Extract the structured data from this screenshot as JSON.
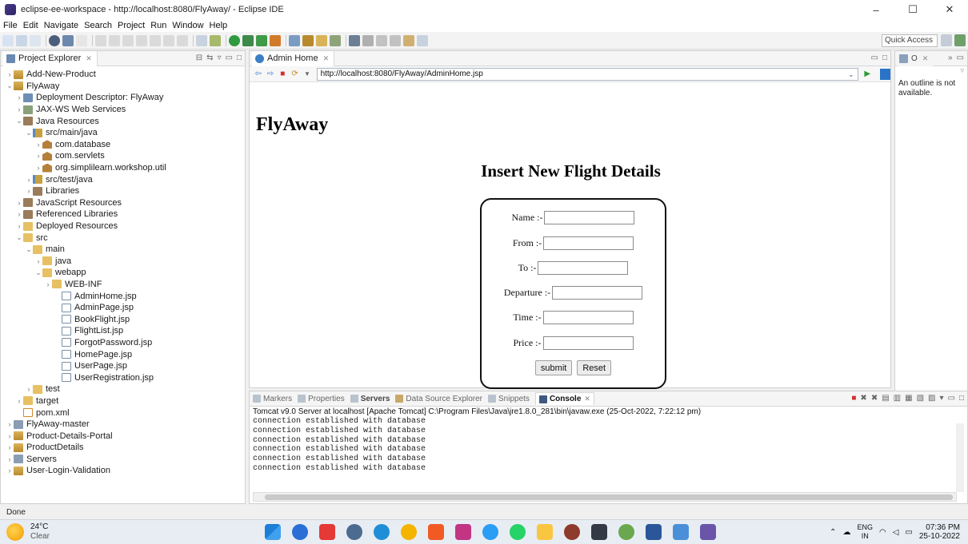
{
  "window": {
    "title": "eclipse-ee-workspace - http://localhost:8080/FlyAway/ - Eclipse IDE",
    "controls": [
      "–",
      "☐",
      "✕"
    ]
  },
  "menu": [
    "File",
    "Edit",
    "Navigate",
    "Search",
    "Project",
    "Run",
    "Window",
    "Help"
  ],
  "toolbar": {
    "quick_access": "Quick Access"
  },
  "project_explorer": {
    "title": "Project Explorer",
    "tree": [
      {
        "label": "Add-New-Product",
        "depth": 0,
        "chev": ">",
        "icon": "proj"
      },
      {
        "label": "FlyAway",
        "depth": 0,
        "chev": "v",
        "icon": "proj"
      },
      {
        "label": "Deployment Descriptor: FlyAway",
        "depth": 1,
        "chev": ">",
        "icon": "dd"
      },
      {
        "label": "JAX-WS Web Services",
        "depth": 1,
        "chev": ">",
        "icon": "ws"
      },
      {
        "label": "Java Resources",
        "depth": 1,
        "chev": "v",
        "icon": "lib"
      },
      {
        "label": "src/main/java",
        "depth": 2,
        "chev": "v",
        "icon": "srcfolder"
      },
      {
        "label": "com.database",
        "depth": 3,
        "chev": ">",
        "icon": "pkg"
      },
      {
        "label": "com.servlets",
        "depth": 3,
        "chev": ">",
        "icon": "pkg"
      },
      {
        "label": "org.simplilearn.workshop.util",
        "depth": 3,
        "chev": ">",
        "icon": "pkg"
      },
      {
        "label": "src/test/java",
        "depth": 2,
        "chev": ">",
        "icon": "srcfolder"
      },
      {
        "label": "Libraries",
        "depth": 2,
        "chev": ">",
        "icon": "lib"
      },
      {
        "label": "JavaScript Resources",
        "depth": 1,
        "chev": ">",
        "icon": "lib"
      },
      {
        "label": "Referenced Libraries",
        "depth": 1,
        "chev": ">",
        "icon": "lib"
      },
      {
        "label": "Deployed Resources",
        "depth": 1,
        "chev": ">",
        "icon": "folder"
      },
      {
        "label": "src",
        "depth": 1,
        "chev": "v",
        "icon": "folder"
      },
      {
        "label": "main",
        "depth": 2,
        "chev": "v",
        "icon": "folder"
      },
      {
        "label": "java",
        "depth": 3,
        "chev": ">",
        "icon": "folder"
      },
      {
        "label": "webapp",
        "depth": 3,
        "chev": "v",
        "icon": "folder"
      },
      {
        "label": "WEB-INF",
        "depth": 4,
        "chev": ">",
        "icon": "folder"
      },
      {
        "label": "AdminHome.jsp",
        "depth": 5,
        "chev": "",
        "icon": "jsp"
      },
      {
        "label": "AdminPage.jsp",
        "depth": 5,
        "chev": "",
        "icon": "jsp"
      },
      {
        "label": "BookFlight.jsp",
        "depth": 5,
        "chev": "",
        "icon": "jsp"
      },
      {
        "label": "FlightList.jsp",
        "depth": 5,
        "chev": "",
        "icon": "jsp"
      },
      {
        "label": "ForgotPassword.jsp",
        "depth": 5,
        "chev": "",
        "icon": "jsp"
      },
      {
        "label": "HomePage.jsp",
        "depth": 5,
        "chev": "",
        "icon": "jsp"
      },
      {
        "label": "UserPage.jsp",
        "depth": 5,
        "chev": "",
        "icon": "jsp"
      },
      {
        "label": "UserRegistration.jsp",
        "depth": 5,
        "chev": "",
        "icon": "jsp"
      },
      {
        "label": "test",
        "depth": 2,
        "chev": ">",
        "icon": "folder"
      },
      {
        "label": "target",
        "depth": 1,
        "chev": ">",
        "icon": "folder"
      },
      {
        "label": "pom.xml",
        "depth": 1,
        "chev": "",
        "icon": "xml"
      },
      {
        "label": "FlyAway-master",
        "depth": 0,
        "chev": ">",
        "icon": "server"
      },
      {
        "label": "Product-Details-Portal",
        "depth": 0,
        "chev": ">",
        "icon": "proj"
      },
      {
        "label": "ProductDetails",
        "depth": 0,
        "chev": ">",
        "icon": "proj"
      },
      {
        "label": "Servers",
        "depth": 0,
        "chev": ">",
        "icon": "server"
      },
      {
        "label": "User-Login-Validation",
        "depth": 0,
        "chev": ">",
        "icon": "proj"
      }
    ]
  },
  "editor": {
    "tab": "Admin Home",
    "url": "http://localhost:8080/FlyAway/AdminHome.jsp",
    "page": {
      "brand": "FlyAway",
      "heading": "Insert New Flight Details",
      "fields": [
        {
          "label": "Name :-",
          "value": ""
        },
        {
          "label": "From :-",
          "value": ""
        },
        {
          "label": "To :-",
          "value": ""
        },
        {
          "label": "Departure :-",
          "value": ""
        },
        {
          "label": "Time :-",
          "value": ""
        },
        {
          "label": "Price :-",
          "value": ""
        }
      ],
      "submit": "submit",
      "reset": "Reset"
    }
  },
  "outline": {
    "message": "An outline is not available."
  },
  "console": {
    "tabs": [
      "Markers",
      "Properties",
      "Servers",
      "Data Source Explorer",
      "Snippets",
      "Console"
    ],
    "header": "Tomcat v9.0 Server at localhost [Apache Tomcat] C:\\Program Files\\Java\\jre1.8.0_281\\bin\\javaw.exe (25-Oct-2022, 7:22:12 pm)",
    "lines": [
      "connection established with database",
      "connection established with database",
      "connection established with database",
      "connection established with database",
      "connection established with database",
      "connection established with database"
    ]
  },
  "status": "Done",
  "taskbar": {
    "temp": "24°C",
    "weather": "Clear",
    "lang": "ENG",
    "region": "IN",
    "time": "07:36 PM",
    "date": "25-10-2022"
  }
}
